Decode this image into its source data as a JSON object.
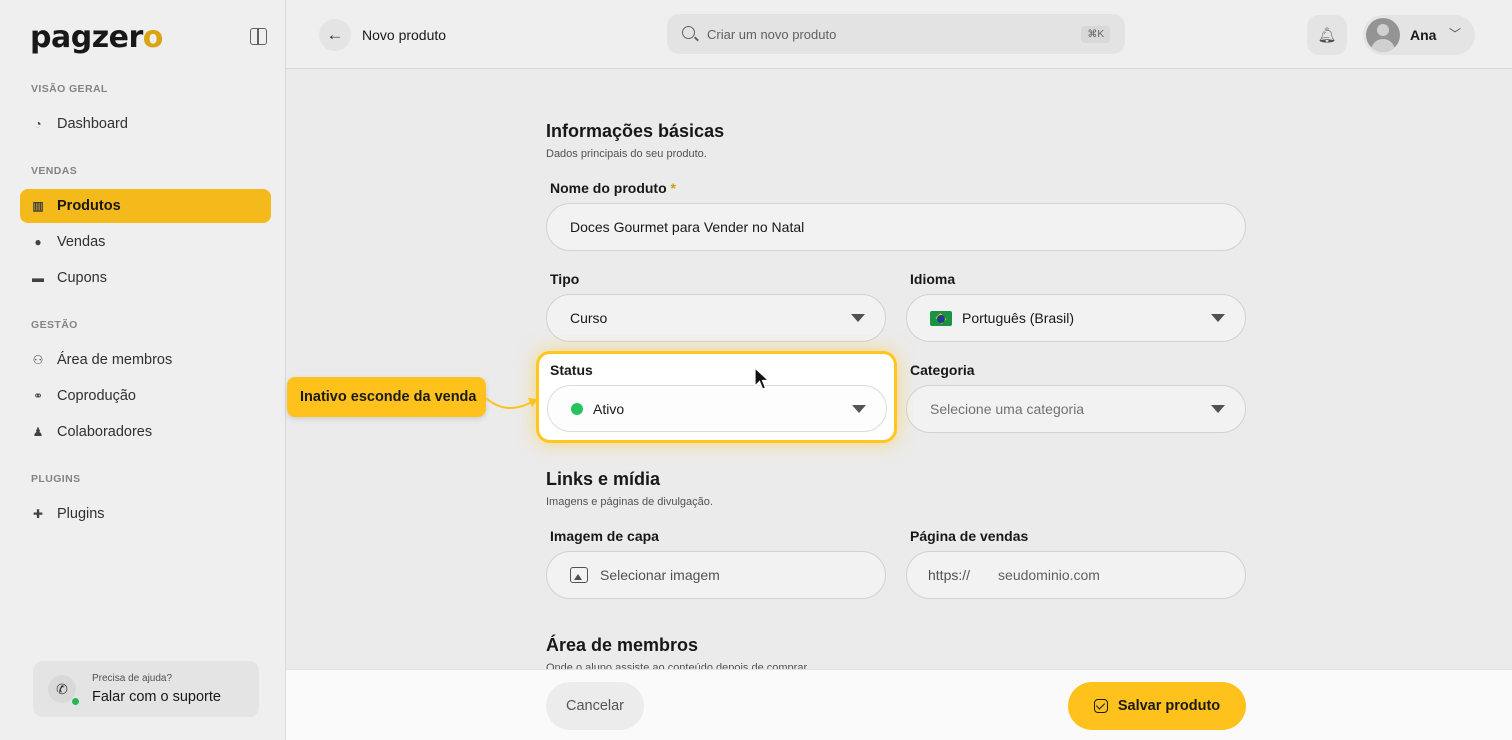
{
  "sidebar": {
    "logo": "pagzer",
    "logo_accent": "o",
    "sections": {
      "overview": "VISÃO GERAL",
      "sales": "VENDAS",
      "management": "GESTÃO",
      "plugins": "PLUGINS"
    },
    "items": [
      {
        "label": "Dashboard",
        "icon": "chart-pie-icon"
      },
      {
        "label": "Produtos",
        "icon": "products-icon",
        "active": true
      },
      {
        "label": "Vendas",
        "icon": "sales-icon"
      },
      {
        "label": "Cupons",
        "icon": "coupon-icon"
      },
      {
        "label": "Área de membros",
        "icon": "members-icon"
      },
      {
        "label": "Coprodução",
        "icon": "handshake-icon"
      },
      {
        "label": "Colaboradores",
        "icon": "user-icon"
      },
      {
        "label": "Plugins",
        "icon": "puzzle-icon"
      }
    ],
    "support": {
      "small": "Precisa de ajuda?",
      "big": "Falar com o suporte",
      "icon": "whatsapp-icon"
    }
  },
  "header": {
    "page_title": "Novo produto",
    "search_placeholder": "Criar um novo produto",
    "shortcut": "⌘K",
    "user_name": "Ana"
  },
  "form": {
    "basic": {
      "title": "Informações básicas",
      "subtitle": "Dados principais do seu produto.",
      "name_label": "Nome do produto",
      "required_mark": "*",
      "name_value": "Doces Gourmet para Vender no Natal",
      "type_label": "Tipo",
      "type_value": "Curso",
      "language_label": "Idioma",
      "language_value": "Português (Brasil)",
      "status_label": "Status",
      "status_value": "Ativo",
      "category_label": "Categoria",
      "category_placeholder": "Selecione uma categoria"
    },
    "links": {
      "title": "Links e mídia",
      "subtitle": "Imagens e páginas de divulgação.",
      "cover_label": "Imagem de capa",
      "cover_button": "Selecionar imagem",
      "sales_page_label": "Página de vendas",
      "sales_page_prefix": "https://",
      "sales_page_placeholder": "seudominio.com"
    },
    "members": {
      "title": "Área de membros",
      "subtitle": "Onde o aluno assiste ao conteúdo depois de comprar."
    }
  },
  "tooltip": {
    "text": "Inativo esconde da venda"
  },
  "footer": {
    "cancel": "Cancelar",
    "save": "Salvar produto"
  },
  "colors": {
    "accent": "#ffc21c",
    "status_active": "#25c25e",
    "online": "#2dbe5d"
  }
}
